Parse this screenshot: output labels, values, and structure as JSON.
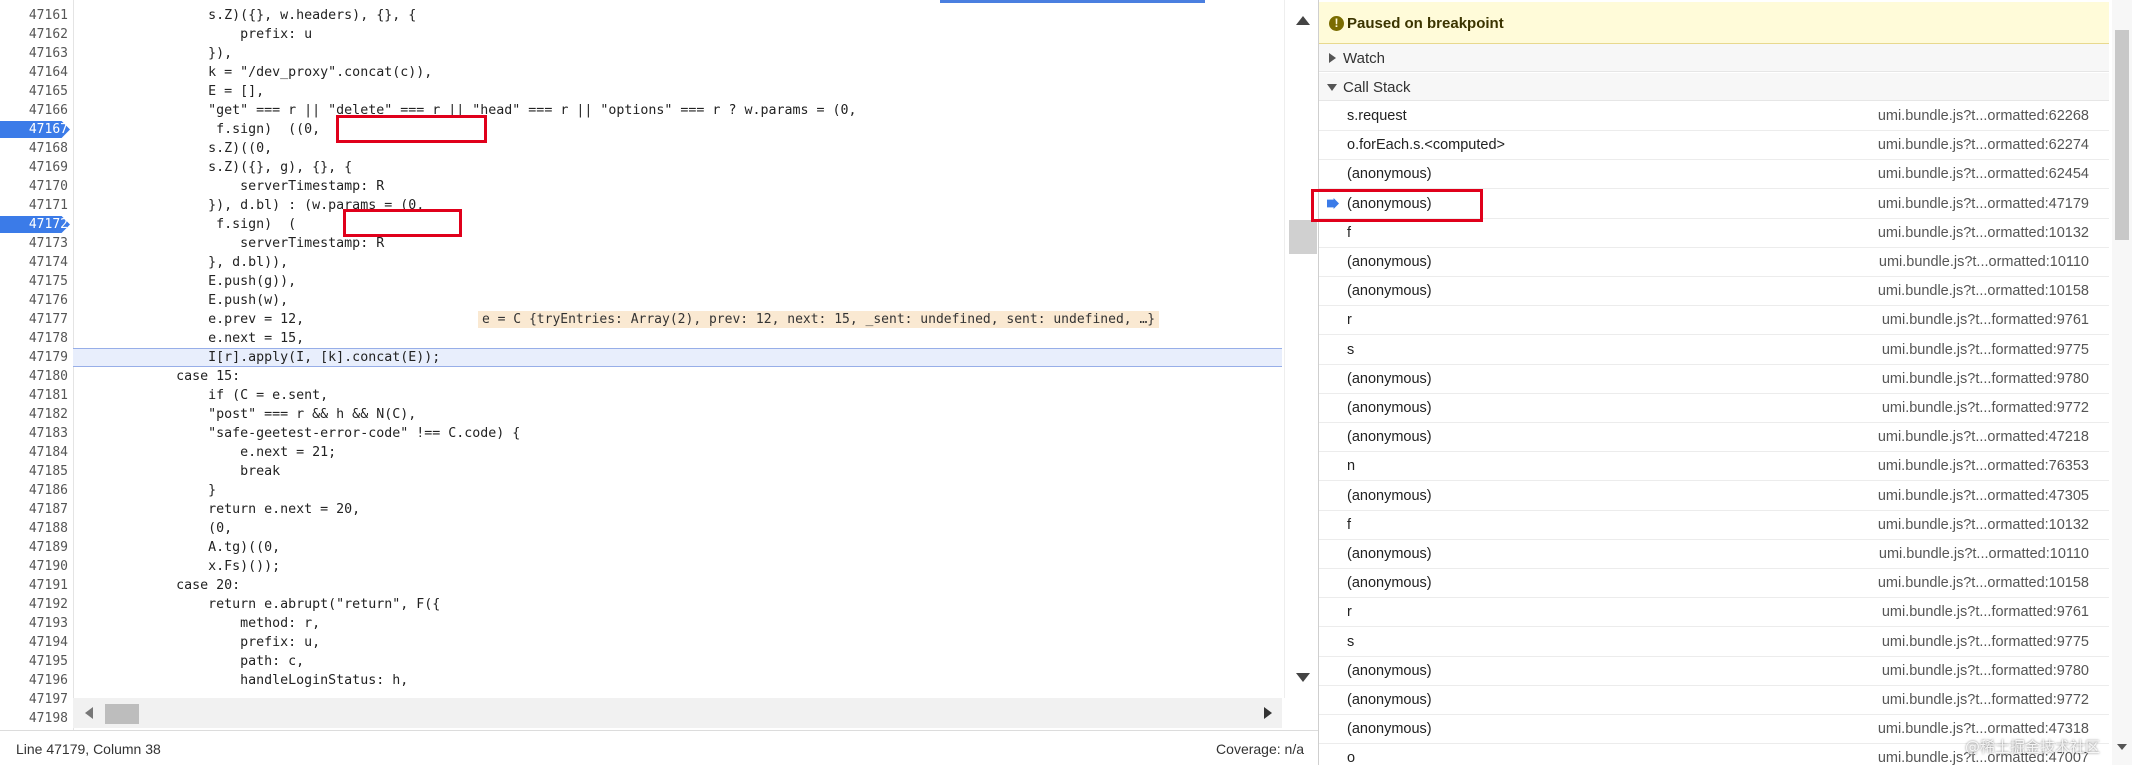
{
  "editor": {
    "lines": [
      {
        "n": "47161",
        "code": "                s.Z)({}, w.headers), {}, {"
      },
      {
        "n": "47162",
        "code": "                    prefix: u"
      },
      {
        "n": "47163",
        "code": "                }),"
      },
      {
        "n": "47164",
        "code": "                k = \"/dev_proxy\".concat(c)),"
      },
      {
        "n": "47165",
        "code": "                E = [],"
      },
      {
        "n": "47166",
        "code": "                \"get\" === r || \"delete\" === r || \"head\" === r || \"options\" === r ? w.params = (0,"
      },
      {
        "n": "47167",
        "code": "                 f.sign)  ((0,",
        "bp": true
      },
      {
        "n": "47168",
        "code": "                s.Z)((0,"
      },
      {
        "n": "47169",
        "code": "                s.Z)({}, g), {}, {"
      },
      {
        "n": "47170",
        "code": "                    serverTimestamp: R"
      },
      {
        "n": "47171",
        "code": "                }), d.bl) : (w.params = (0,"
      },
      {
        "n": "47172",
        "code": "                 f.sign)  (",
        "bp": true
      },
      {
        "n": "47173",
        "code": "                    serverTimestamp: R"
      },
      {
        "n": "47174",
        "code": "                }, d.bl)),"
      },
      {
        "n": "47175",
        "code": "                E.push(g)),"
      },
      {
        "n": "47176",
        "code": "                E.push(w),"
      },
      {
        "n": "47177",
        "code": "                e.prev = 12,"
      },
      {
        "n": "47178",
        "code": "                e.next = 15,"
      },
      {
        "n": "47179",
        "code": "                I[r].apply(I, [k].concat(E));",
        "current": true
      },
      {
        "n": "47180",
        "code": "            case 15:"
      },
      {
        "n": "47181",
        "code": "                if (C = e.sent,"
      },
      {
        "n": "47182",
        "code": "                \"post\" === r && h && N(C),"
      },
      {
        "n": "47183",
        "code": "                \"safe-geetest-error-code\" !== C.code) {"
      },
      {
        "n": "47184",
        "code": "                    e.next = 21;"
      },
      {
        "n": "47185",
        "code": "                    break"
      },
      {
        "n": "47186",
        "code": "                }"
      },
      {
        "n": "47187",
        "code": "                return e.next = 20,"
      },
      {
        "n": "47188",
        "code": "                (0,"
      },
      {
        "n": "47189",
        "code": "                A.tg)((0,"
      },
      {
        "n": "47190",
        "code": "                x.Fs)());"
      },
      {
        "n": "47191",
        "code": "            case 20:"
      },
      {
        "n": "47192",
        "code": "                return e.abrupt(\"return\", F({"
      },
      {
        "n": "47193",
        "code": "                    method: r,"
      },
      {
        "n": "47194",
        "code": "                    prefix: u,"
      },
      {
        "n": "47195",
        "code": "                    path: c,"
      },
      {
        "n": "47196",
        "code": "                    handleLoginStatus: h,"
      },
      {
        "n": "47197",
        "code": ""
      },
      {
        "n": "47198",
        "code": ""
      }
    ],
    "inline_value": "e = C {tryEntries: Array(2), prev: 12, next: 15, _sent: undefined, sent: undefined, …}"
  },
  "status": {
    "position": "Line 47179, Column 38",
    "coverage": "Coverage: n/a"
  },
  "sidebar": {
    "paused_banner": "Paused on breakpoint",
    "watch_label": "Watch",
    "callstack_label": "Call Stack",
    "frames": [
      {
        "name": "s.request",
        "loc": "umi.bundle.js?t...ormatted:62268"
      },
      {
        "name": "o.forEach.s.<computed>",
        "loc": "umi.bundle.js?t...ormatted:62274"
      },
      {
        "name": "(anonymous)",
        "loc": "umi.bundle.js?t...ormatted:62454"
      },
      {
        "name": "(anonymous)",
        "loc": "umi.bundle.js?t...ormatted:47179",
        "current": true
      },
      {
        "name": "f",
        "loc": "umi.bundle.js?t...ormatted:10132"
      },
      {
        "name": "(anonymous)",
        "loc": "umi.bundle.js?t...ormatted:10110"
      },
      {
        "name": "(anonymous)",
        "loc": "umi.bundle.js?t...ormatted:10158"
      },
      {
        "name": "r",
        "loc": "umi.bundle.js?t...formatted:9761"
      },
      {
        "name": "s",
        "loc": "umi.bundle.js?t...formatted:9775"
      },
      {
        "name": "(anonymous)",
        "loc": "umi.bundle.js?t...formatted:9780"
      },
      {
        "name": "(anonymous)",
        "loc": "umi.bundle.js?t...formatted:9772"
      },
      {
        "name": "(anonymous)",
        "loc": "umi.bundle.js?t...ormatted:47218"
      },
      {
        "name": "n",
        "loc": "umi.bundle.js?t...ormatted:76353"
      },
      {
        "name": "(anonymous)",
        "loc": "umi.bundle.js?t...ormatted:47305"
      },
      {
        "name": "f",
        "loc": "umi.bundle.js?t...ormatted:10132"
      },
      {
        "name": "(anonymous)",
        "loc": "umi.bundle.js?t...ormatted:10110"
      },
      {
        "name": "(anonymous)",
        "loc": "umi.bundle.js?t...ormatted:10158"
      },
      {
        "name": "r",
        "loc": "umi.bundle.js?t...formatted:9761"
      },
      {
        "name": "s",
        "loc": "umi.bundle.js?t...formatted:9775"
      },
      {
        "name": "(anonymous)",
        "loc": "umi.bundle.js?t...formatted:9780"
      },
      {
        "name": "(anonymous)",
        "loc": "umi.bundle.js?t...formatted:9772"
      },
      {
        "name": "(anonymous)",
        "loc": "umi.bundle.js?t...ormatted:47318"
      },
      {
        "name": "o",
        "loc": "umi.bundle.js?t...ormatted:47007"
      }
    ]
  },
  "watermark": "@稀土掘金技术社区",
  "colors": {
    "breakpoint": "#3b7be8",
    "highlight_box": "#e0001b",
    "paused_bg": "#fffbd9",
    "current_line": "#e8eefc",
    "inline_value_bg": "#fae9d2"
  }
}
